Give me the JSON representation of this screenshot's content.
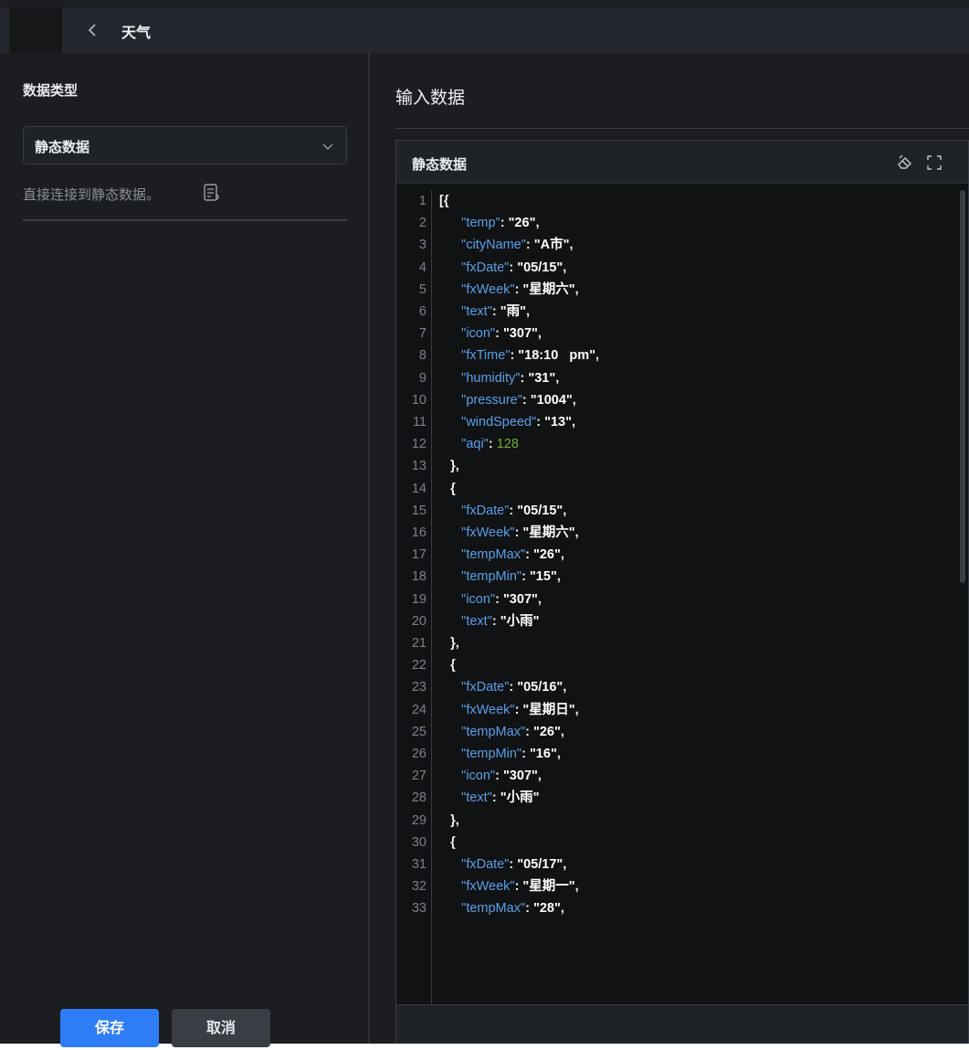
{
  "topbar": {
    "title": "天气",
    "back_icon": "chevron-left-icon"
  },
  "left": {
    "data_type_label": "数据类型",
    "select_value": "静态数据",
    "hint": "直接连接到静态数据。",
    "hint_icon": "doc-help-icon",
    "save_label": "保存",
    "cancel_label": "取消"
  },
  "right": {
    "title": "输入数据",
    "editor_title": "静态数据",
    "icons": [
      "erase-icon",
      "fullscreen-icon"
    ]
  },
  "code_lines": [
    [
      {
        "t": "p",
        "s": "[{"
      }
    ],
    [
      {
        "t": "i",
        "s": "      "
      },
      {
        "t": "k",
        "s": "\"temp\""
      },
      {
        "t": "p",
        "s": ": "
      },
      {
        "t": "v",
        "s": "\"26\""
      },
      {
        "t": "p",
        "s": ","
      }
    ],
    [
      {
        "t": "i",
        "s": "      "
      },
      {
        "t": "k",
        "s": "\"cityName\""
      },
      {
        "t": "p",
        "s": ": "
      },
      {
        "t": "v",
        "s": "\"A市\""
      },
      {
        "t": "p",
        "s": ","
      }
    ],
    [
      {
        "t": "i",
        "s": "      "
      },
      {
        "t": "k",
        "s": "\"fxDate\""
      },
      {
        "t": "p",
        "s": ": "
      },
      {
        "t": "v",
        "s": "\"05/15\""
      },
      {
        "t": "p",
        "s": ","
      }
    ],
    [
      {
        "t": "i",
        "s": "      "
      },
      {
        "t": "k",
        "s": "\"fxWeek\""
      },
      {
        "t": "p",
        "s": ": "
      },
      {
        "t": "v",
        "s": "\"星期六\""
      },
      {
        "t": "p",
        "s": ","
      }
    ],
    [
      {
        "t": "i",
        "s": "      "
      },
      {
        "t": "k",
        "s": "\"text\""
      },
      {
        "t": "p",
        "s": ": "
      },
      {
        "t": "v",
        "s": "\"雨\""
      },
      {
        "t": "p",
        "s": ","
      }
    ],
    [
      {
        "t": "i",
        "s": "      "
      },
      {
        "t": "k",
        "s": "\"icon\""
      },
      {
        "t": "p",
        "s": ": "
      },
      {
        "t": "v",
        "s": "\"307\""
      },
      {
        "t": "p",
        "s": ","
      }
    ],
    [
      {
        "t": "i",
        "s": "      "
      },
      {
        "t": "k",
        "s": "\"fxTime\""
      },
      {
        "t": "p",
        "s": ": "
      },
      {
        "t": "v",
        "s": "\"18:10   pm\""
      },
      {
        "t": "p",
        "s": ","
      }
    ],
    [
      {
        "t": "i",
        "s": "      "
      },
      {
        "t": "k",
        "s": "\"humidity\""
      },
      {
        "t": "p",
        "s": ": "
      },
      {
        "t": "v",
        "s": "\"31\""
      },
      {
        "t": "p",
        "s": ","
      }
    ],
    [
      {
        "t": "i",
        "s": "      "
      },
      {
        "t": "k",
        "s": "\"pressure\""
      },
      {
        "t": "p",
        "s": ": "
      },
      {
        "t": "v",
        "s": "\"1004\""
      },
      {
        "t": "p",
        "s": ","
      }
    ],
    [
      {
        "t": "i",
        "s": "      "
      },
      {
        "t": "k",
        "s": "\"windSpeed\""
      },
      {
        "t": "p",
        "s": ": "
      },
      {
        "t": "v",
        "s": "\"13\""
      },
      {
        "t": "p",
        "s": ","
      }
    ],
    [
      {
        "t": "i",
        "s": "      "
      },
      {
        "t": "k",
        "s": "\"aqi\""
      },
      {
        "t": "p",
        "s": ": "
      },
      {
        "t": "n",
        "s": "128"
      }
    ],
    [
      {
        "t": "i",
        "s": "   "
      },
      {
        "t": "p",
        "s": "},"
      }
    ],
    [
      {
        "t": "i",
        "s": "   "
      },
      {
        "t": "p",
        "s": "{"
      }
    ],
    [
      {
        "t": "i",
        "s": "      "
      },
      {
        "t": "k",
        "s": "\"fxDate\""
      },
      {
        "t": "p",
        "s": ": "
      },
      {
        "t": "v",
        "s": "\"05/15\""
      },
      {
        "t": "p",
        "s": ","
      }
    ],
    [
      {
        "t": "i",
        "s": "      "
      },
      {
        "t": "k",
        "s": "\"fxWeek\""
      },
      {
        "t": "p",
        "s": ": "
      },
      {
        "t": "v",
        "s": "\"星期六\""
      },
      {
        "t": "p",
        "s": ","
      }
    ],
    [
      {
        "t": "i",
        "s": "      "
      },
      {
        "t": "k",
        "s": "\"tempMax\""
      },
      {
        "t": "p",
        "s": ": "
      },
      {
        "t": "v",
        "s": "\"26\""
      },
      {
        "t": "p",
        "s": ","
      }
    ],
    [
      {
        "t": "i",
        "s": "      "
      },
      {
        "t": "k",
        "s": "\"tempMin\""
      },
      {
        "t": "p",
        "s": ": "
      },
      {
        "t": "v",
        "s": "\"15\""
      },
      {
        "t": "p",
        "s": ","
      }
    ],
    [
      {
        "t": "i",
        "s": "      "
      },
      {
        "t": "k",
        "s": "\"icon\""
      },
      {
        "t": "p",
        "s": ": "
      },
      {
        "t": "v",
        "s": "\"307\""
      },
      {
        "t": "p",
        "s": ","
      }
    ],
    [
      {
        "t": "i",
        "s": "      "
      },
      {
        "t": "k",
        "s": "\"text\""
      },
      {
        "t": "p",
        "s": ": "
      },
      {
        "t": "v",
        "s": "\"小雨\""
      }
    ],
    [
      {
        "t": "i",
        "s": "   "
      },
      {
        "t": "p",
        "s": "},"
      }
    ],
    [
      {
        "t": "i",
        "s": "   "
      },
      {
        "t": "p",
        "s": "{"
      }
    ],
    [
      {
        "t": "i",
        "s": "      "
      },
      {
        "t": "k",
        "s": "\"fxDate\""
      },
      {
        "t": "p",
        "s": ": "
      },
      {
        "t": "v",
        "s": "\"05/16\""
      },
      {
        "t": "p",
        "s": ","
      }
    ],
    [
      {
        "t": "i",
        "s": "      "
      },
      {
        "t": "k",
        "s": "\"fxWeek\""
      },
      {
        "t": "p",
        "s": ": "
      },
      {
        "t": "v",
        "s": "\"星期日\""
      },
      {
        "t": "p",
        "s": ","
      }
    ],
    [
      {
        "t": "i",
        "s": "      "
      },
      {
        "t": "k",
        "s": "\"tempMax\""
      },
      {
        "t": "p",
        "s": ": "
      },
      {
        "t": "v",
        "s": "\"26\""
      },
      {
        "t": "p",
        "s": ","
      }
    ],
    [
      {
        "t": "i",
        "s": "      "
      },
      {
        "t": "k",
        "s": "\"tempMin\""
      },
      {
        "t": "p",
        "s": ": "
      },
      {
        "t": "v",
        "s": "\"16\""
      },
      {
        "t": "p",
        "s": ","
      }
    ],
    [
      {
        "t": "i",
        "s": "      "
      },
      {
        "t": "k",
        "s": "\"icon\""
      },
      {
        "t": "p",
        "s": ": "
      },
      {
        "t": "v",
        "s": "\"307\""
      },
      {
        "t": "p",
        "s": ","
      }
    ],
    [
      {
        "t": "i",
        "s": "      "
      },
      {
        "t": "k",
        "s": "\"text\""
      },
      {
        "t": "p",
        "s": ": "
      },
      {
        "t": "v",
        "s": "\"小雨\""
      }
    ],
    [
      {
        "t": "i",
        "s": "   "
      },
      {
        "t": "p",
        "s": "},"
      }
    ],
    [
      {
        "t": "i",
        "s": "   "
      },
      {
        "t": "p",
        "s": "{"
      }
    ],
    [
      {
        "t": "i",
        "s": "      "
      },
      {
        "t": "k",
        "s": "\"fxDate\""
      },
      {
        "t": "p",
        "s": ": "
      },
      {
        "t": "v",
        "s": "\"05/17\""
      },
      {
        "t": "p",
        "s": ","
      }
    ],
    [
      {
        "t": "i",
        "s": "      "
      },
      {
        "t": "k",
        "s": "\"fxWeek\""
      },
      {
        "t": "p",
        "s": ": "
      },
      {
        "t": "v",
        "s": "\"星期一\""
      },
      {
        "t": "p",
        "s": ","
      }
    ],
    [
      {
        "t": "i",
        "s": "      "
      },
      {
        "t": "k",
        "s": "\"tempMax\""
      },
      {
        "t": "p",
        "s": ": "
      },
      {
        "t": "v",
        "s": "\"28\""
      },
      {
        "t": "p",
        "s": ","
      }
    ]
  ]
}
